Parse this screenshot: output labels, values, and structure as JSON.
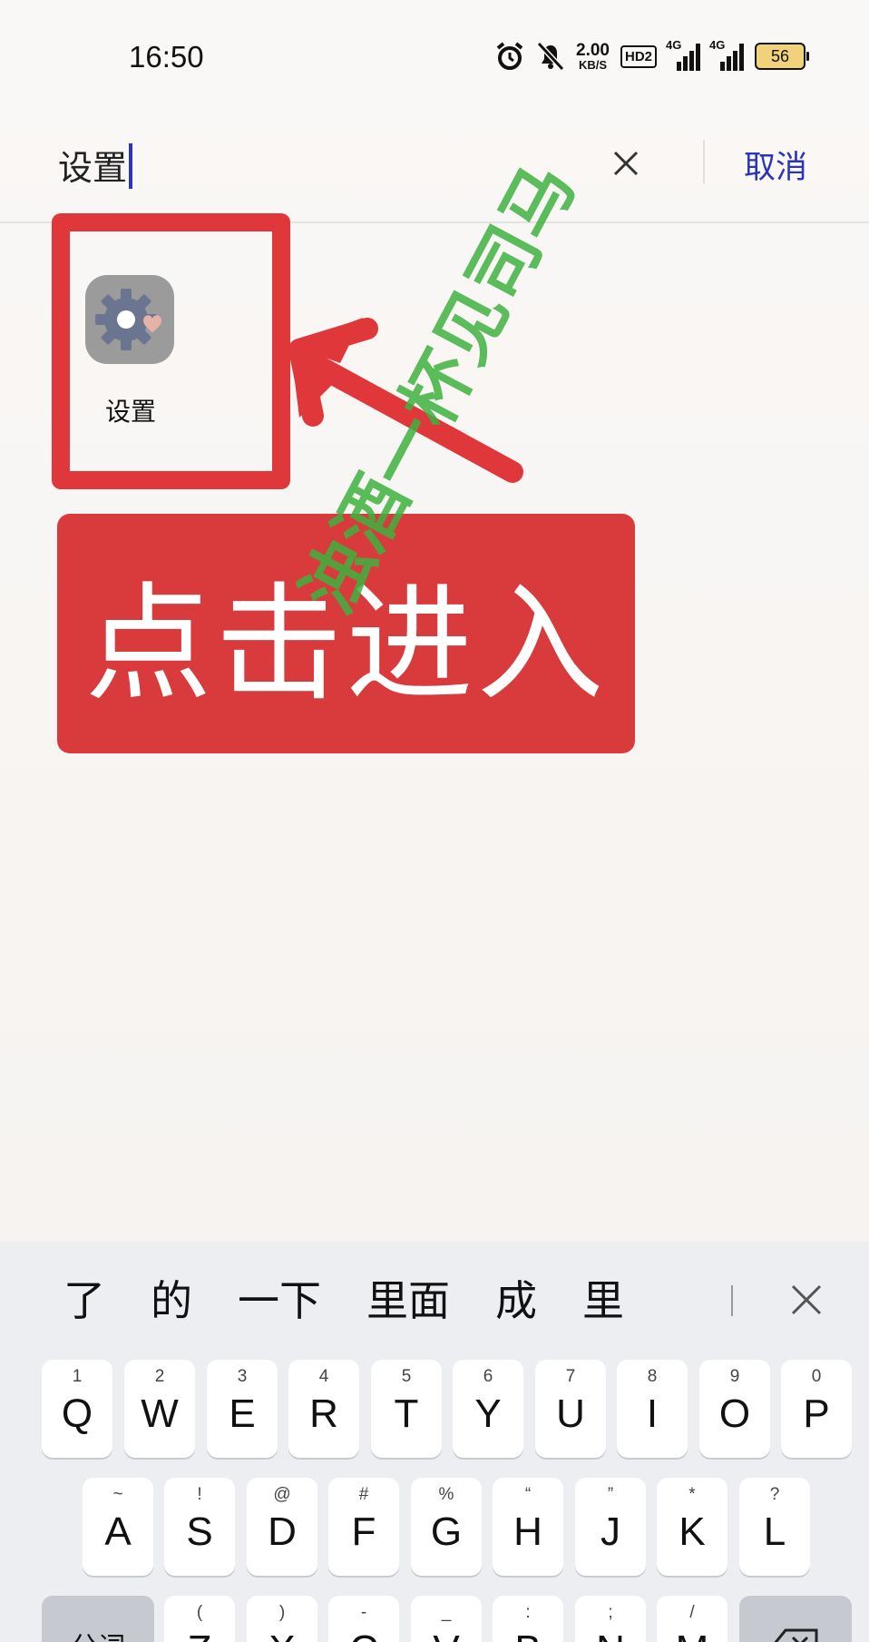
{
  "status": {
    "time": "16:50",
    "speed_value": "2.00",
    "speed_unit": "KB/S",
    "hd": "HD2",
    "sig1": "4G",
    "sig2": "4G",
    "battery": "56"
  },
  "search": {
    "query": "设置",
    "cancel_label": "取消"
  },
  "result": {
    "app_label": "设置"
  },
  "overlay": {
    "cta": "点击进入",
    "watermark": "浊酒一杯见司马"
  },
  "keyboard": {
    "suggestions": [
      "了",
      "的",
      "一下",
      "里面",
      "成",
      "里"
    ],
    "row1": [
      {
        "hint": "1",
        "key": "Q"
      },
      {
        "hint": "2",
        "key": "W"
      },
      {
        "hint": "3",
        "key": "E"
      },
      {
        "hint": "4",
        "key": "R"
      },
      {
        "hint": "5",
        "key": "T"
      },
      {
        "hint": "6",
        "key": "Y"
      },
      {
        "hint": "7",
        "key": "U"
      },
      {
        "hint": "8",
        "key": "I"
      },
      {
        "hint": "9",
        "key": "O"
      },
      {
        "hint": "0",
        "key": "P"
      }
    ],
    "row2": [
      {
        "hint": "~",
        "key": "A"
      },
      {
        "hint": "!",
        "key": "S"
      },
      {
        "hint": "@",
        "key": "D"
      },
      {
        "hint": "#",
        "key": "F"
      },
      {
        "hint": "%",
        "key": "G"
      },
      {
        "hint": "“",
        "key": "H"
      },
      {
        "hint": "”",
        "key": "J"
      },
      {
        "hint": "*",
        "key": "K"
      },
      {
        "hint": "?",
        "key": "L"
      }
    ],
    "row3": [
      {
        "hint": "(",
        "key": "Z"
      },
      {
        "hint": ")",
        "key": "X"
      },
      {
        "hint": "-",
        "key": "C"
      },
      {
        "hint": "_",
        "key": "V"
      },
      {
        "hint": ":",
        "key": "B"
      },
      {
        "hint": ";",
        "key": "N"
      },
      {
        "hint": "/",
        "key": "M"
      }
    ],
    "segment_label": "分词"
  },
  "icons": {
    "app_icon": "settings-gear-icon",
    "clear": "close-icon",
    "delete": "backspace-icon"
  }
}
